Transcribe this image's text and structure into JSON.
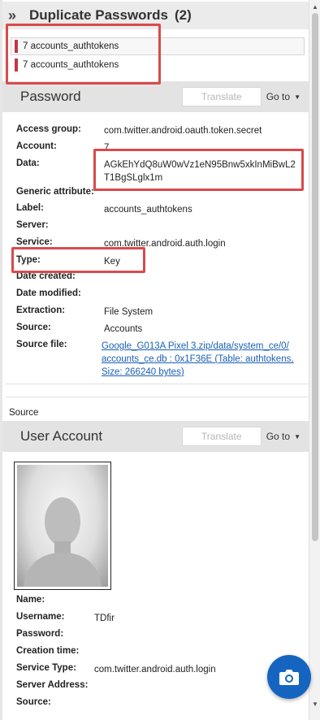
{
  "duplicates": {
    "title": "Duplicate Passwords",
    "count": "(2)",
    "items": [
      {
        "label": "7 accounts_authtokens"
      },
      {
        "label": "7 accounts_authtokens"
      }
    ]
  },
  "password": {
    "title": "Password",
    "translate_label": "Translate",
    "goto_label": "Go to",
    "fields": {
      "access_group": {
        "label": "Access group:",
        "value": "com.twitter.android.oauth.token.secret"
      },
      "account": {
        "label": "Account:",
        "value": "7"
      },
      "data": {
        "label": "Data:",
        "value_line1": "AGkEhYdQ8uW0wVz1eN95Bnw5xkInMiBwL2",
        "value_line2": "T1BgSLglx1m"
      },
      "generic_attribute": {
        "label": "Generic attribute:"
      },
      "label": {
        "label": "Label:",
        "value": "accounts_authtokens"
      },
      "server": {
        "label": "Server:"
      },
      "service": {
        "label": "Service:",
        "value": "com.twitter.android.auth.login"
      },
      "type": {
        "label": "Type:",
        "value": "Key"
      },
      "date_created": {
        "label": "Date created:"
      },
      "date_modified": {
        "label": "Date modified:"
      },
      "extraction": {
        "label": "Extraction:",
        "value": "File System"
      },
      "source": {
        "label": "Source:",
        "value": "Accounts"
      },
      "source_file": {
        "label": "Source file:",
        "line1": "Google_G013A Pixel 3.zip/data/system_ce/0/",
        "line2": "accounts_ce.db : 0x1F36E (Table: authtokens,",
        "line3": "Size: 266240 bytes)"
      }
    }
  },
  "source_caption": "Source",
  "user_account": {
    "title": "User Account",
    "translate_label": "Translate",
    "goto_label": "Go to",
    "fields": {
      "name": {
        "label": "Name:"
      },
      "username": {
        "label": "Username:",
        "value": "TDfir"
      },
      "password": {
        "label": "Password:"
      },
      "creation_time": {
        "label": "Creation time:"
      },
      "service_type": {
        "label": "Service Type:",
        "value": "com.twitter.android.auth.login"
      },
      "server_address": {
        "label": "Server Address:"
      },
      "source": {
        "label": "Source:"
      }
    }
  },
  "icons": {
    "collapse": "double-chevron-right-icon",
    "camera": "camera-icon",
    "avatar": "default-user-silhouette"
  },
  "colors": {
    "highlight": "#d84b4b",
    "marker": "#c0374a",
    "link": "#1a5fb4",
    "fab": "#1565c0"
  }
}
